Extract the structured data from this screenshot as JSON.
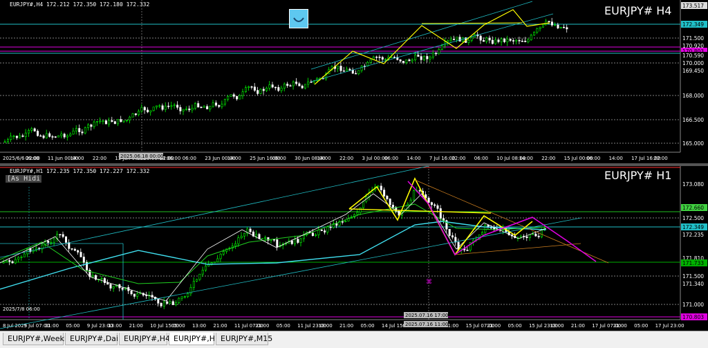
{
  "h4": {
    "info": "EURJPY#,H4  172.212 172.350 172.180 172.332",
    "title": "EURJPY# H4",
    "price_labels": [
      {
        "text": "173.517",
        "bg": "#dcdcdc",
        "fg": "#000"
      },
      {
        "text": "172.349",
        "bg": "#20c0c8",
        "fg": "#000"
      },
      {
        "text": "171.500",
        "bg": "#000",
        "fg": "#fff"
      },
      {
        "text": "170.920",
        "bg": "#000",
        "fg": "#fff"
      },
      {
        "text": "170.803",
        "bg": "#e000e0",
        "fg": "#000"
      },
      {
        "text": "170.590",
        "bg": "#000",
        "fg": "#fff"
      },
      {
        "text": "170.000",
        "bg": "#000",
        "fg": "#fff"
      },
      {
        "text": "169.450",
        "bg": "#000",
        "fg": "#fff"
      },
      {
        "text": "168.000",
        "bg": "#000",
        "fg": "#fff"
      },
      {
        "text": "166.500",
        "bg": "#000",
        "fg": "#fff"
      },
      {
        "text": "165.000",
        "bg": "#000",
        "fg": "#fff"
      }
    ],
    "time_labels": [
      "2025/6/6 22:00",
      "06:00",
      "11 Jun 00:00",
      "14:00",
      "22:00",
      "13 Jun 08:00",
      "2025.06.18 06:00",
      "22:00",
      "06:00",
      "23 Jun 00:00",
      "14:00",
      "25 Jun 16:00",
      "06:00",
      "30 Jun 08:00",
      "14:00",
      "22:00",
      "3 Jul 00:00",
      "06:00",
      "14:00",
      "7 Jul 16:00",
      "22:00",
      "06:00",
      "10 Jul 08:00",
      "14:00",
      "22:00",
      "15 Jul 00:00",
      "06:00",
      "14:00",
      "17 Jul 16:00",
      "22:00"
    ],
    "cursor_label": "2025.06.18 00:00"
  },
  "h1": {
    "info": "EURJPY#,H1  172.235 172.350 172.227 172.332",
    "badge": "[As Hidi",
    "title": "EURJPY# H1",
    "price_labels": [
      {
        "text": "173.080",
        "bg": "#000",
        "fg": "#fff"
      },
      {
        "text": "172.660",
        "bg": "#40d040",
        "fg": "#000"
      },
      {
        "text": "172.500",
        "bg": "#000",
        "fg": "#fff"
      },
      {
        "text": "172.349",
        "bg": "#20c0c8",
        "fg": "#000"
      },
      {
        "text": "172.235",
        "bg": "#000",
        "fg": "#fff"
      },
      {
        "text": "171.810",
        "bg": "#000",
        "fg": "#fff"
      },
      {
        "text": "171.733",
        "bg": "#00b000",
        "fg": "#000"
      },
      {
        "text": "171.500",
        "bg": "#000",
        "fg": "#fff"
      },
      {
        "text": "171.340",
        "bg": "#000",
        "fg": "#fff"
      },
      {
        "text": "171.000",
        "bg": "#000",
        "fg": "#fff"
      },
      {
        "text": "170.803",
        "bg": "#e000e0",
        "fg": "#000"
      }
    ],
    "time_labels": [
      "8 Jul 2025",
      "9 Jul 07:00",
      "21:00",
      "05:00",
      "9 Jul 23:00",
      "13:00",
      "21:00",
      "10 Jul 15:00",
      "05:00",
      "13:00",
      "21:00",
      "11 Jul 07:00",
      "21:00",
      "05:00",
      "11 Jul 23:00",
      "13:00",
      "21:00",
      "05:00",
      "14 Jul 15:00",
      "05:00",
      "13:00",
      "21:00",
      "15 Jul 07:00",
      "21:00",
      "05:00",
      "15 Jul 23:00",
      "13:00",
      "21:00",
      "17 Jul 07:00",
      "21:00",
      "05:00",
      "17 Jul 23:00"
    ],
    "cursor_label_top": "2025.07.16 17:00",
    "cursor_label_bottom": "2025.07.16 11:00",
    "left_date": "2025/7/8 06:00"
  },
  "tabs": [
    "EURJPY#,Weekly",
    "EURJPY#,Daily",
    "EURJPY#,H4",
    "EURJPY#,H1",
    "EURJPY#,M15"
  ],
  "active_tab": "EURJPY#,H1",
  "colors": {
    "bull": "#00ff00",
    "bear": "#ffffff",
    "zigzag": "#ffff00",
    "channel": "#20c0c8",
    "magenta": "#e000e0",
    "ma_white": "#ffffff",
    "ma_green": "#20d020",
    "ma_cyan": "#40e0f0"
  }
}
